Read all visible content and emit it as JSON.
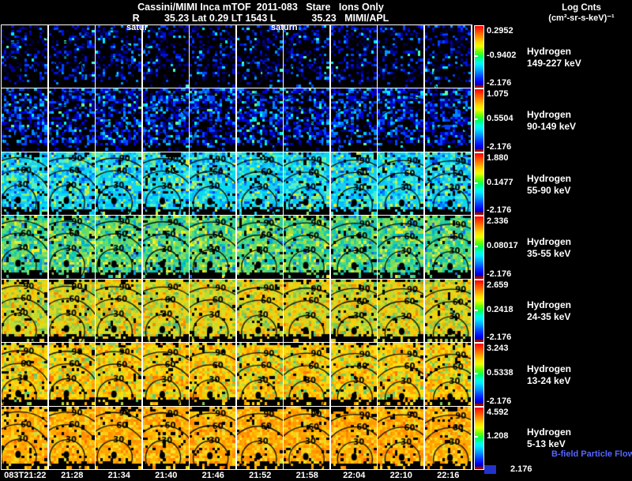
{
  "header": {
    "title_line1": "Cassini/MIMI Inca mTOF  2011-083   Stare   Ions Only",
    "title_line2": "R         35.23 Lat 0.29 LT 1543 L             35.23   MIMI/APL",
    "legend_title": "Log Cnts",
    "legend_units": "(cm²-sr-s-keV)⁻¹"
  },
  "annotations": [
    "satur",
    "saturn"
  ],
  "footer": {
    "bfield_note": "B-field Particle Flow"
  },
  "chart_data": {
    "type": "heatmap",
    "title": "Cassini/MIMI Inca mTOF 2011-083 Stare Ions Only",
    "subtitle": "R 35.23 Lat 0.29 LT 1543 L 35.23 MIMI/APL",
    "colorbar_title": "Log Cnts (cm²-sr-s-keV)⁻¹",
    "grid": {
      "columns": 10,
      "rows": 7
    },
    "x_axis": {
      "tick_labels": [
        "083T21:22",
        "21:28",
        "21:34",
        "21:40",
        "21:46",
        "21:52",
        "21:58",
        "22:04",
        "22:10",
        "22:16"
      ]
    },
    "contour_labels": [
      "30",
      "60",
      "90"
    ],
    "colormap": [
      "#ff0000",
      "#ff8800",
      "#ffdd00",
      "#66ff00",
      "#00ffdd",
      "#0099ff",
      "#0000ee",
      "#990000"
    ],
    "rows": [
      {
        "species": "Hydrogen",
        "energy": "149-227 keV",
        "scale_top": "0.2952",
        "scale_mid": "-0.9402",
        "scale_bottom": "-2.176",
        "render": {
          "cy": 0.78,
          "labels": false,
          "palette": [
            [
              "#000000",
              0.6
            ],
            [
              "#000044",
              0.1
            ],
            [
              "#000099",
              0.1
            ],
            [
              "#0011dd",
              0.09
            ],
            [
              "#0044ff",
              0.06
            ],
            [
              "#0099ff",
              0.03
            ],
            [
              "#00eeff",
              0.015
            ],
            [
              "#44ffcc",
              0.005
            ]
          ]
        }
      },
      {
        "species": "Hydrogen",
        "energy": "90-149 keV",
        "scale_top": "1.075",
        "scale_mid": "0.5504",
        "scale_bottom": "-2.176",
        "render": {
          "cy": 0.78,
          "labels": false,
          "palette": [
            [
              "#000000",
              0.4
            ],
            [
              "#000088",
              0.13
            ],
            [
              "#0000dd",
              0.16
            ],
            [
              "#0044ff",
              0.14
            ],
            [
              "#0088ff",
              0.09
            ],
            [
              "#00ccff",
              0.05
            ],
            [
              "#00ffee",
              0.02
            ],
            [
              "#66ff99",
              0.01
            ]
          ]
        }
      },
      {
        "species": "Hydrogen",
        "energy": "55-90 keV",
        "scale_top": "1.880",
        "scale_mid": "0.1477",
        "scale_bottom": "-2.176",
        "render": {
          "cy": 0.8,
          "labels": true,
          "palette": [
            [
              "#000000",
              0.09
            ],
            [
              "#00ddee",
              0.2
            ],
            [
              "#22ccee",
              0.16
            ],
            [
              "#00bbff",
              0.13
            ],
            [
              "#44eedd",
              0.13
            ],
            [
              "#0088ff",
              0.08
            ],
            [
              "#66eeaa",
              0.08
            ],
            [
              "#0044ee",
              0.05
            ],
            [
              "#99ee55",
              0.05
            ],
            [
              "#ddee33",
              0.03
            ]
          ]
        }
      },
      {
        "species": "Hydrogen",
        "energy": "35-55 keV",
        "scale_top": "2.336",
        "scale_mid": "0.08017",
        "scale_bottom": "-2.176",
        "render": {
          "cy": 0.8,
          "labels": true,
          "palette": [
            [
              "#000000",
              0.08
            ],
            [
              "#55dd77",
              0.18
            ],
            [
              "#33cc99",
              0.16
            ],
            [
              "#77dd55",
              0.14
            ],
            [
              "#00ccbb",
              0.12
            ],
            [
              "#aadd44",
              0.1
            ],
            [
              "#00aadd",
              0.08
            ],
            [
              "#ddee33",
              0.07
            ],
            [
              "#ffee11",
              0.04
            ],
            [
              "#2266ee",
              0.03
            ]
          ]
        }
      },
      {
        "species": "Hydrogen",
        "energy": "24-35 keV",
        "scale_top": "2.659",
        "scale_mid": "0.2418",
        "scale_bottom": "-2.176",
        "render": {
          "cy": 0.82,
          "labels": true,
          "palette": [
            [
              "#000000",
              0.07
            ],
            [
              "#dddd22",
              0.18
            ],
            [
              "#eecc11",
              0.17
            ],
            [
              "#bbdd33",
              0.14
            ],
            [
              "#ffcc00",
              0.12
            ],
            [
              "#99cc44",
              0.1
            ],
            [
              "#ffaa00",
              0.08
            ],
            [
              "#77cc55",
              0.07
            ],
            [
              "#ff8800",
              0.04
            ],
            [
              "#44bb88",
              0.03
            ]
          ]
        }
      },
      {
        "species": "Hydrogen",
        "energy": "13-24 keV",
        "scale_top": "3.243",
        "scale_mid": "0.5338",
        "scale_bottom": "-2.176",
        "render": {
          "cy": 0.85,
          "labels": true,
          "palette": [
            [
              "#000000",
              0.06
            ],
            [
              "#ffcc00",
              0.2
            ],
            [
              "#ffdd11",
              0.16
            ],
            [
              "#ffaa00",
              0.14
            ],
            [
              "#eedd22",
              0.12
            ],
            [
              "#ff9900",
              0.1
            ],
            [
              "#bbdd33",
              0.09
            ],
            [
              "#88cc55",
              0.06
            ],
            [
              "#ff7700",
              0.04
            ],
            [
              "#55cc77",
              0.03
            ]
          ]
        }
      },
      {
        "species": "Hydrogen",
        "energy": "5-13 keV",
        "scale_top": "4.592",
        "scale_mid": "1.208",
        "scale_bottom": "2.176",
        "render": {
          "cy": 0.8,
          "labels": true,
          "palette": [
            [
              "#000000",
              0.07
            ],
            [
              "#ffaa00",
              0.2
            ],
            [
              "#ff9900",
              0.17
            ],
            [
              "#ffbb00",
              0.15
            ],
            [
              "#ffcc11",
              0.12
            ],
            [
              "#ff8800",
              0.1
            ],
            [
              "#eedd22",
              0.08
            ],
            [
              "#ffdd33",
              0.06
            ],
            [
              "#ff6600",
              0.03
            ],
            [
              "#ccdd44",
              0.02
            ]
          ]
        }
      }
    ]
  }
}
